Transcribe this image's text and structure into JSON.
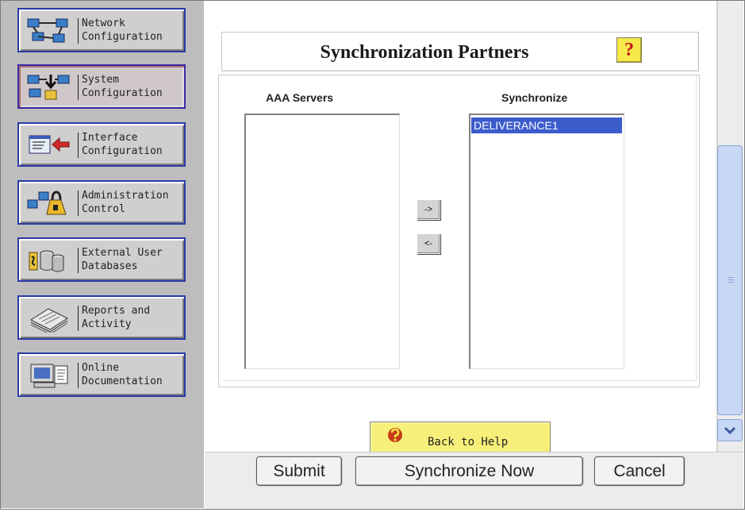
{
  "nav": {
    "items": [
      {
        "label": "Network\nConfiguration"
      },
      {
        "label": "System\nConfiguration"
      },
      {
        "label": "Interface\nConfiguration"
      },
      {
        "label": "Administration\nControl"
      },
      {
        "label": "External User\nDatabases"
      },
      {
        "label": "Reports and\nActivity"
      },
      {
        "label": "Online\nDocumentation"
      }
    ]
  },
  "page": {
    "title": "Synchronization Partners",
    "help_glyph": "?",
    "aaa_servers_label": "AAA Servers",
    "synchronize_label": "Synchronize",
    "aaa_servers_items": [],
    "synchronize_items": [
      "DELIVERANCE1"
    ],
    "move_right_label": "->",
    "move_left_label": "<-",
    "back_to_help_label": "Back to Help"
  },
  "buttons": {
    "submit": "Submit",
    "synchronize_now": "Synchronize Now",
    "cancel": "Cancel"
  },
  "colors": {
    "selection": "#3c5ccc",
    "nav_border": "#2a3aa6",
    "help_yellow": "#f6e94a",
    "scroll_blue": "#c8d8f4"
  }
}
